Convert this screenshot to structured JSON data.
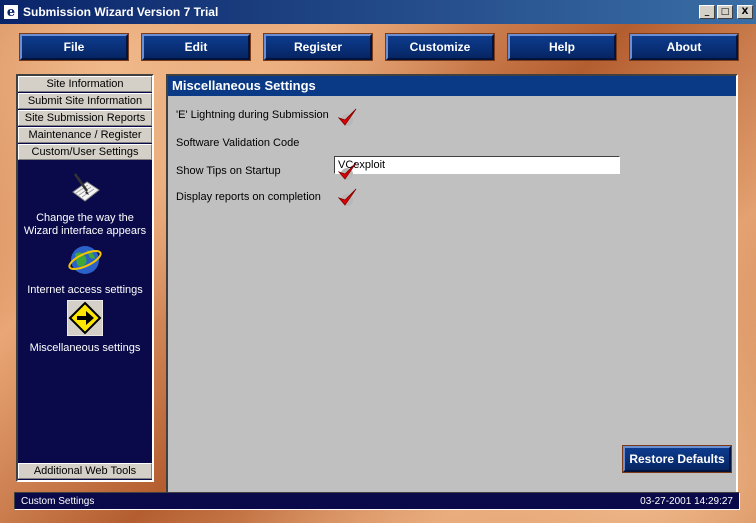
{
  "window": {
    "title": "Submission Wizard Version 7 Trial",
    "app_icon": "e",
    "controls": {
      "minimize": "_",
      "maximize": "□",
      "close": "X"
    }
  },
  "menu": {
    "items": [
      {
        "label": "File"
      },
      {
        "label": "Edit"
      },
      {
        "label": "Register"
      },
      {
        "label": "Customize"
      },
      {
        "label": "Help"
      },
      {
        "label": "About"
      }
    ]
  },
  "sidebar": {
    "items": [
      {
        "label": "Site Information"
      },
      {
        "label": "Submit Site Information"
      },
      {
        "label": "Site Submission Reports"
      },
      {
        "label": "Maintenance / Register"
      },
      {
        "label": "Custom/User Settings"
      }
    ],
    "tools": [
      {
        "label_line1": "Change the way the",
        "label_line2": "Wizard interface appears",
        "icon": "notepad-pen-icon"
      },
      {
        "label_line1": "Internet access settings",
        "icon": "globe-icon"
      },
      {
        "label_line1": "Miscellaneous settings",
        "icon": "arrow-sign-icon"
      }
    ],
    "bottom_item": "Additional Web Tools"
  },
  "panel": {
    "title": "Miscellaneous Settings",
    "settings": [
      {
        "label": "'E' Lightning during Submission",
        "checked": true
      },
      {
        "label": "Software Validation Code",
        "value": "VCexploit"
      },
      {
        "label": "Show Tips on Startup",
        "checked": true
      },
      {
        "label": "Display reports on completion",
        "checked": true
      }
    ],
    "restore_label": "Restore Defaults"
  },
  "status": {
    "left": "Custom Settings",
    "right": "03-27-2001 14:29:27"
  },
  "colors": {
    "title_blue": "#0a246a",
    "button_blue": "#0d3c8e",
    "nav_navy": "#0a0a4a",
    "copper": "#c46c3a",
    "check_red": "#e00000"
  }
}
